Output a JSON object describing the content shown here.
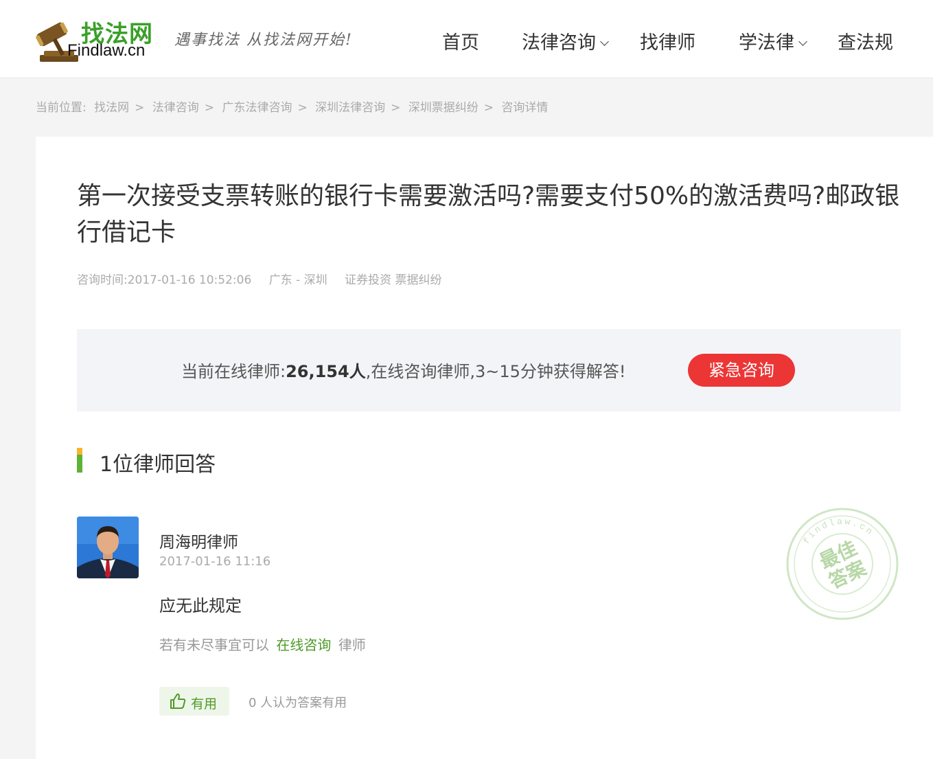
{
  "header": {
    "logo_cn": "找法网",
    "logo_en": "Findlaw.cn",
    "slogan": "遇事找法 从找法网开始!",
    "nav": [
      {
        "label": "首页"
      },
      {
        "label": "法律咨询"
      },
      {
        "label": "找律师"
      },
      {
        "label": "学法律"
      },
      {
        "label": "查法规"
      }
    ]
  },
  "breadcrumb": {
    "prefix": "当前位置:",
    "items": [
      "找法网",
      "法律咨询",
      "广东法律咨询",
      "深圳法律咨询",
      "深圳票据纠纷",
      "咨询详情"
    ],
    "separator": ">"
  },
  "question": {
    "title": "第一次接受支票转账的银行卡需要激活吗?需要支付50%的激活费吗?邮政银行借记卡",
    "time": "咨询时间:2017-01-16 10:52:06",
    "location": "广东 - 深圳",
    "category": "证券投资 票据纠纷"
  },
  "online": {
    "prefix": "当前在线律师:",
    "count": "26,154人",
    "suffix": ",在线咨询律师,3~15分钟获得解答!",
    "button": "紧急咨询"
  },
  "answers": {
    "heading": "1位律师回答",
    "items": [
      {
        "lawyer": "周海明律师",
        "time": "2017-01-16 11:16",
        "content": "应无此规定",
        "more_prefix": "若有未尽事宜可以",
        "more_link": "在线咨询",
        "more_suffix": "律师",
        "useful_label": "有用",
        "useful_count": "0 人认为答案有用"
      }
    ]
  },
  "stamp": {
    "line1": "最佳",
    "line2": "答案",
    "ring_text": "findlaw.cn"
  },
  "colors": {
    "brand_green": "#3aa028",
    "link_green": "#4e9a28",
    "urgent_red": "#ec3535",
    "bar_yellow": "#f6b530",
    "bar_green": "#5fb236"
  }
}
